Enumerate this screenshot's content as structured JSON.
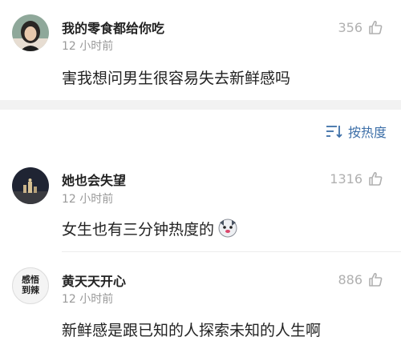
{
  "comments": [
    {
      "username": "我的零食都给你吃",
      "time": "12 小时前",
      "likes": "356",
      "text": "害我想问男生很容易失去新鲜感吗",
      "avatar": "avatar-woman-photo"
    },
    {
      "username": "她也会失望",
      "time": "12 小时前",
      "likes": "1316",
      "text": "女生也有三分钟热度的",
      "avatar": "avatar-night-city-photo",
      "emoji": "dog-face-emoji"
    },
    {
      "username": "黄天天开心",
      "time": "12 小时前",
      "likes": "886",
      "text": "新鲜感是跟已知的人探索未知的人生啊",
      "avatar": "avatar-text-sticker",
      "avatar_text": "感悟到辣"
    }
  ],
  "sort": {
    "label": "按热度",
    "icon": "sort-icon"
  },
  "colors": {
    "link": "#3d6fa8",
    "muted": "#9a9a9a",
    "band": "#f2f2f2"
  }
}
